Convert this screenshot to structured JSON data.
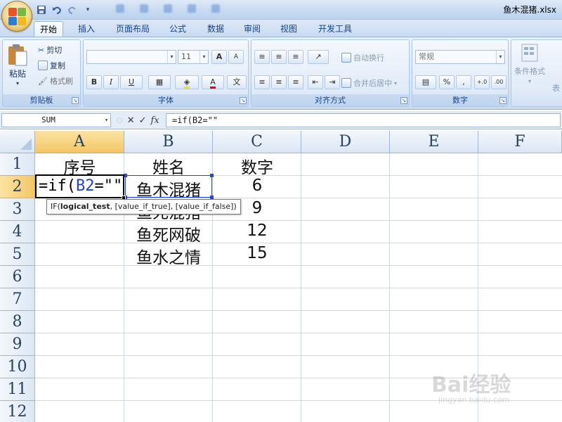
{
  "window": {
    "title": "鱼木混猪.xlsx"
  },
  "quick_access": {
    "icons": [
      "save-icon",
      "undo-icon",
      "redo-icon",
      "customize-icon"
    ]
  },
  "ribbon": {
    "tabs": [
      "开始",
      "插入",
      "页面布局",
      "公式",
      "数据",
      "审阅",
      "视图",
      "开发工具"
    ],
    "active_tab": "开始",
    "clipboard": {
      "label": "剪贴板",
      "paste": "粘贴",
      "cut": "剪切",
      "copy": "复制",
      "format_painter": "格式刷"
    },
    "font": {
      "label": "字体",
      "font_name": "",
      "font_size": "11",
      "bold": "B",
      "italic": "I",
      "underline": "U",
      "grow": "A",
      "shrink": "A"
    },
    "alignment": {
      "label": "对齐方式",
      "wrap_text": "自动换行",
      "merge_center": "合并后居中"
    },
    "number": {
      "label": "数字",
      "format": "常规",
      "percent": "%",
      "comma": ",",
      "increase_decimal": "+.0",
      "decrease_decimal": ".00"
    },
    "styles": {
      "conditional_formatting": "条件格式",
      "table_partial": "表"
    }
  },
  "formula_bar": {
    "name_box": "SUM",
    "cancel": "✕",
    "enter": "✓",
    "fx": "fx",
    "formula": "=if(B2=\"\""
  },
  "sheet": {
    "columns": [
      "A",
      "B",
      "C",
      "D",
      "E",
      "F"
    ],
    "selected_column": "A",
    "rows": [
      "1",
      "2",
      "3",
      "4",
      "5",
      "6",
      "7",
      "8",
      "9",
      "10",
      "11",
      "12"
    ],
    "selected_row": "2",
    "cells": {
      "A1": "序号",
      "B1": "姓名",
      "C1": "数字",
      "B2": "鱼木混猪",
      "C2": "6",
      "B3": "鱼死混猪",
      "C3": "9",
      "B4": "鱼死网破",
      "C4": "12",
      "B5": "鱼水之情",
      "C5": "15"
    },
    "active_cell": {
      "address": "A2",
      "text_prefix": "=if(",
      "text_ref": "B2",
      "text_suffix": "=\"\""
    },
    "tooltip": {
      "fn": "IF(",
      "arg1": "logical_test",
      "rest": ", [value_if_true], [value_if_false])"
    }
  },
  "watermark": {
    "main": "Bai经验",
    "sub": "jingyan.baidu.com"
  }
}
